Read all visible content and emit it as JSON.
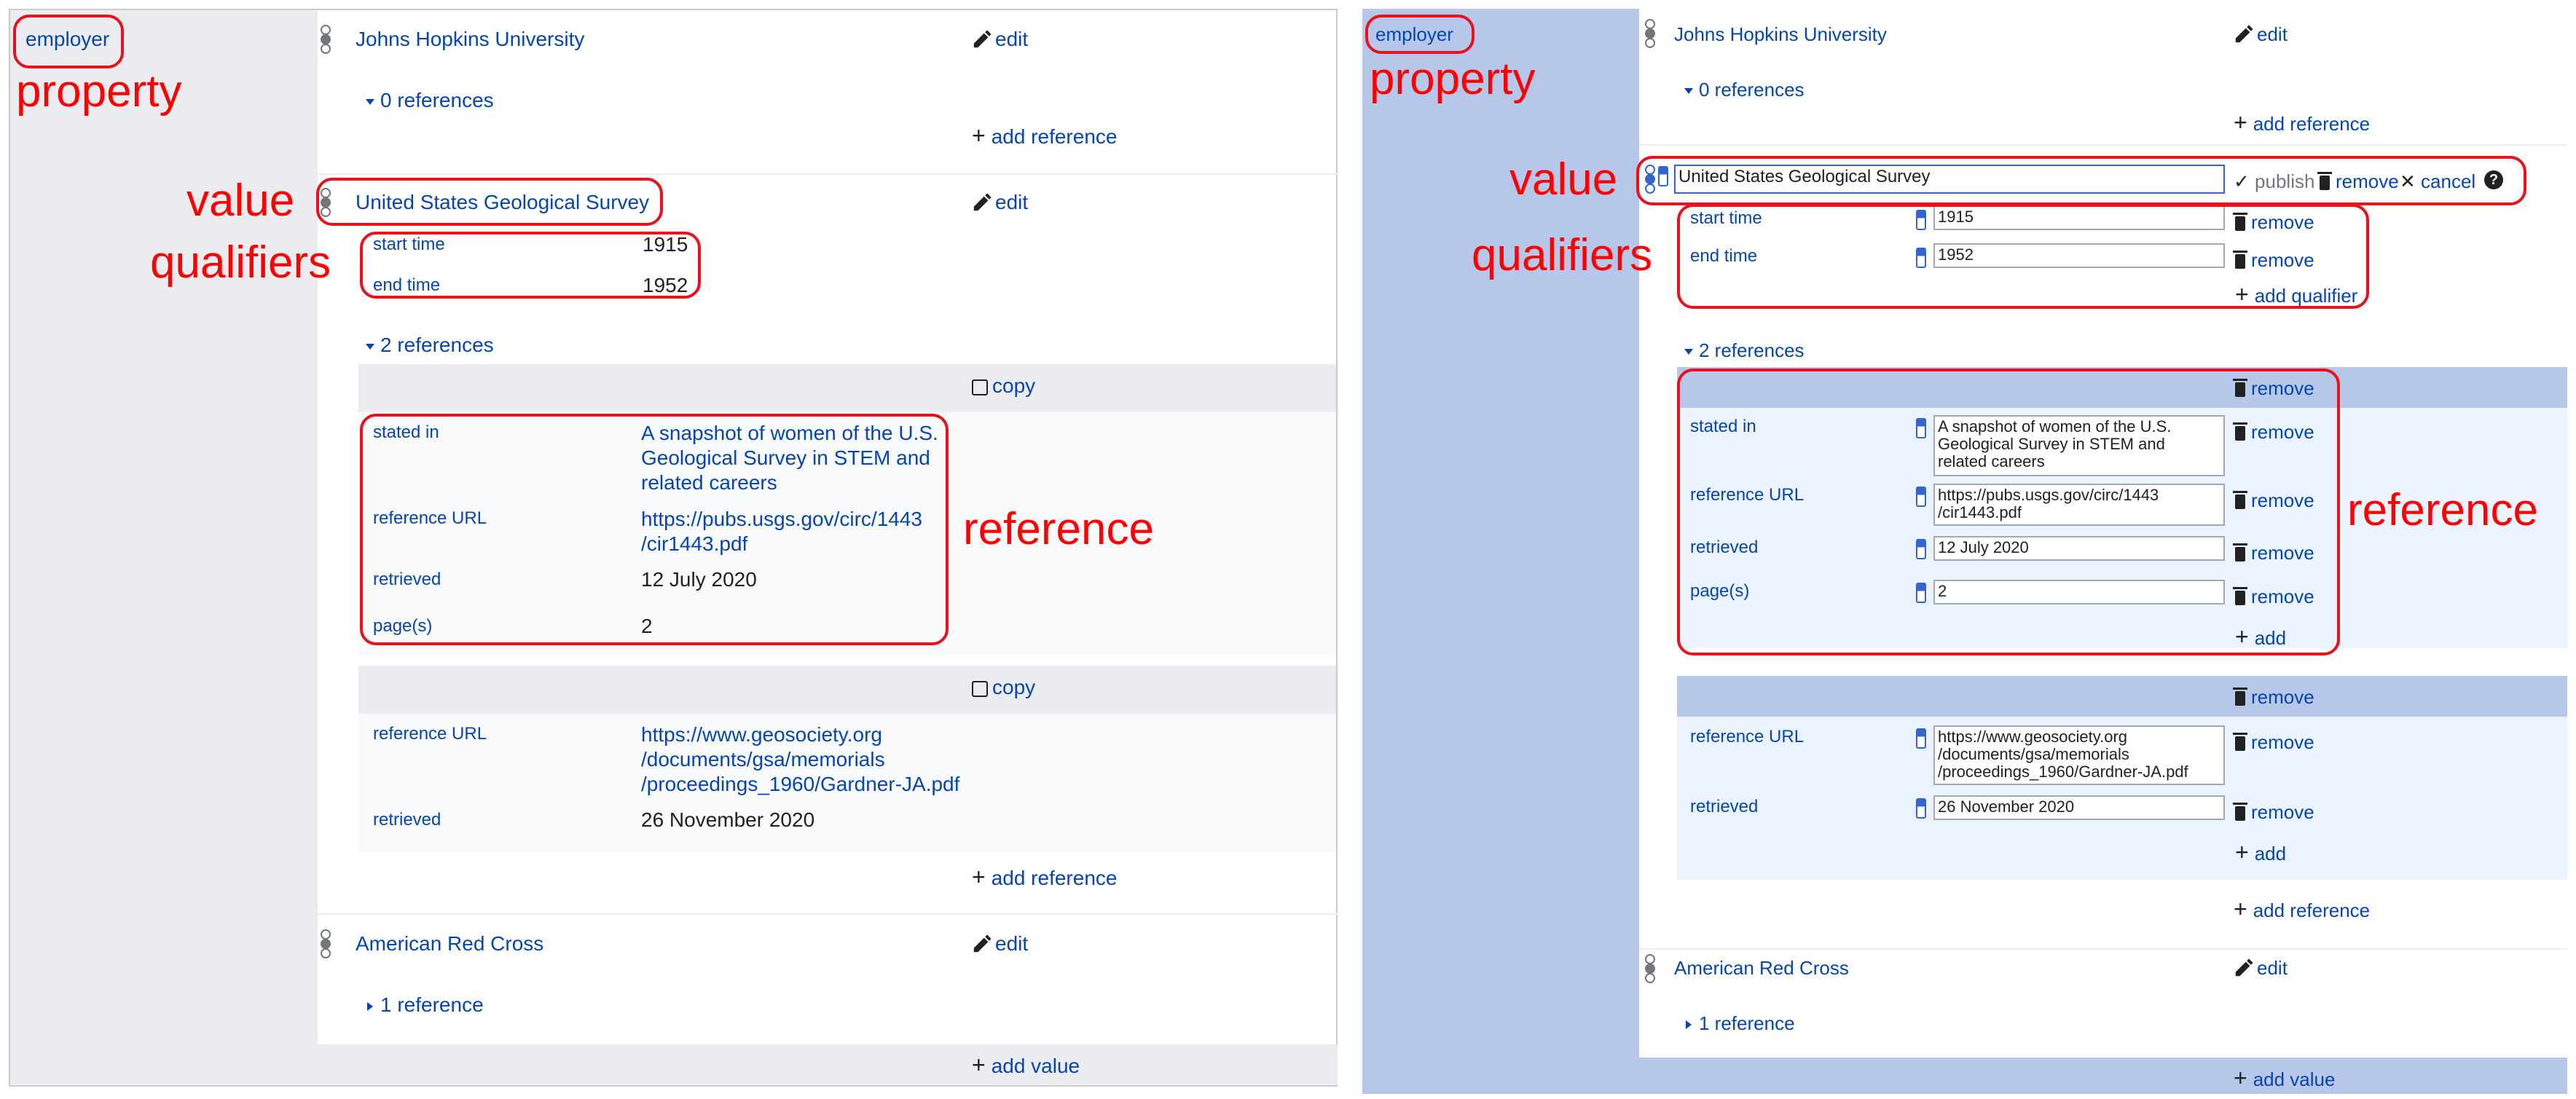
{
  "annotations": {
    "property": "property",
    "value": "value",
    "qualifiers": "qualifiers",
    "reference": "reference"
  },
  "property_label": "employer",
  "actions": {
    "edit": "edit",
    "add_reference": "add reference",
    "add_value": "add value",
    "add_qualifier": "add qualifier",
    "add": "add",
    "copy": "copy",
    "remove": "remove",
    "publish": "publish",
    "cancel": "cancel"
  },
  "statements": {
    "s1": {
      "value": "Johns Hopkins University",
      "refs_toggle": "0 references"
    },
    "s2": {
      "value": "United States Geological Survey",
      "qualifiers": [
        {
          "label": "start time",
          "value": "1915"
        },
        {
          "label": "end time",
          "value": "1952"
        }
      ],
      "refs_toggle": "2 references",
      "ref1": [
        {
          "label": "stated in",
          "value": "A snapshot of women of the U.S. Geological Survey in STEM and related careers"
        },
        {
          "label": "reference URL",
          "value": "https://pubs.usgs.gov/circ/1443/cir1443.pdf"
        },
        {
          "label": "retrieved",
          "value": "12 July 2020"
        },
        {
          "label": "page(s)",
          "value": "2"
        }
      ],
      "ref2": [
        {
          "label": "reference URL",
          "value": "https://www.geosociety.org/documents/gsa/memorials/proceedings_1960/Gardner-JA.pdf"
        },
        {
          "label": "retrieved",
          "value": "26 November 2020"
        }
      ]
    },
    "s3": {
      "value": "American Red Cross",
      "refs_toggle": "1 reference"
    }
  },
  "left_wrapped": {
    "ref1_stated_in": "A snapshot of women of the U.S.\nGeological Survey in STEM and\nrelated careers",
    "ref1_url": "https://pubs.usgs.gov/circ/1443\n/cir1443.pdf",
    "ref2_url": "https://www.geosociety.org\n/documents/gsa/memorials\n/proceedings_1960/Gardner-JA.pdf"
  },
  "right_wrapped": {
    "ref1_stated_in": "A snapshot of women of the U.S.\nGeological Survey in STEM and\nrelated careers",
    "ref1_url": "https://pubs.usgs.gov/circ/1443\n/cir1443.pdf",
    "ref2_url": "https://www.geosociety.org\n/documents/gsa/memorials\n/proceedings_1960/Gardner-JA.pdf"
  },
  "colors": {
    "left_property_bg": "#eaecf0",
    "right_property_bg": "#b7c7ea",
    "ref_header_left": "#eaecf0",
    "ref_body_left": "#f8f9fa",
    "ref_header_right": "#b7c7ea",
    "ref_body_right": "#eaf3ff",
    "annotation_red": "#e8111c",
    "link_blue": "#0645ad"
  }
}
